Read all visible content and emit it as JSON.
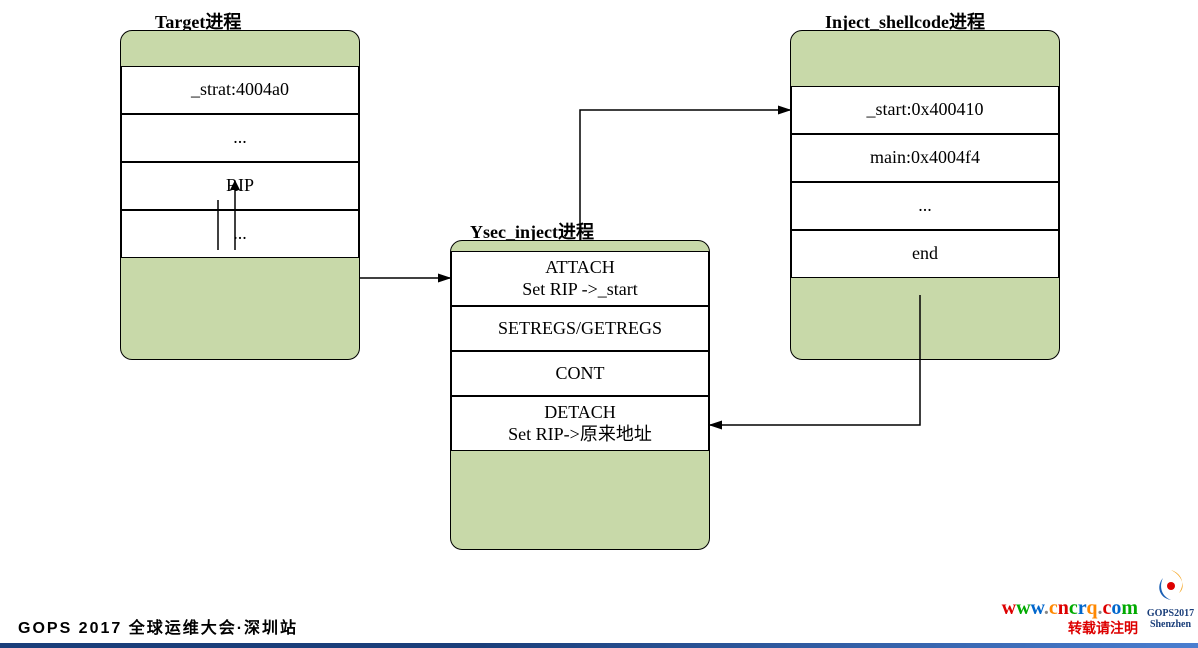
{
  "boxes": {
    "target": {
      "title": "Target进程",
      "cells": [
        "_strat:4004a0",
        "...",
        "RIP",
        "..."
      ]
    },
    "ysec": {
      "title": "Ysec_inject进程",
      "cells": [
        "ATTACH\nSet RIP ->_start",
        "SETREGS/GETREGS",
        "CONT",
        "DETACH\nSet RIP->原来地址"
      ]
    },
    "inject": {
      "title": "Inject_shellcode进程",
      "cells": [
        "_start:0x400410",
        "main:0x4004f4",
        "...",
        "end"
      ]
    }
  },
  "footer": "GOPS 2017 全球运维大会·深圳站",
  "watermark_host": "www.cncrq.com",
  "watermark_note": "转载请注明",
  "logo": {
    "line1": "GOPS2017",
    "line2": "Shenzhen"
  }
}
